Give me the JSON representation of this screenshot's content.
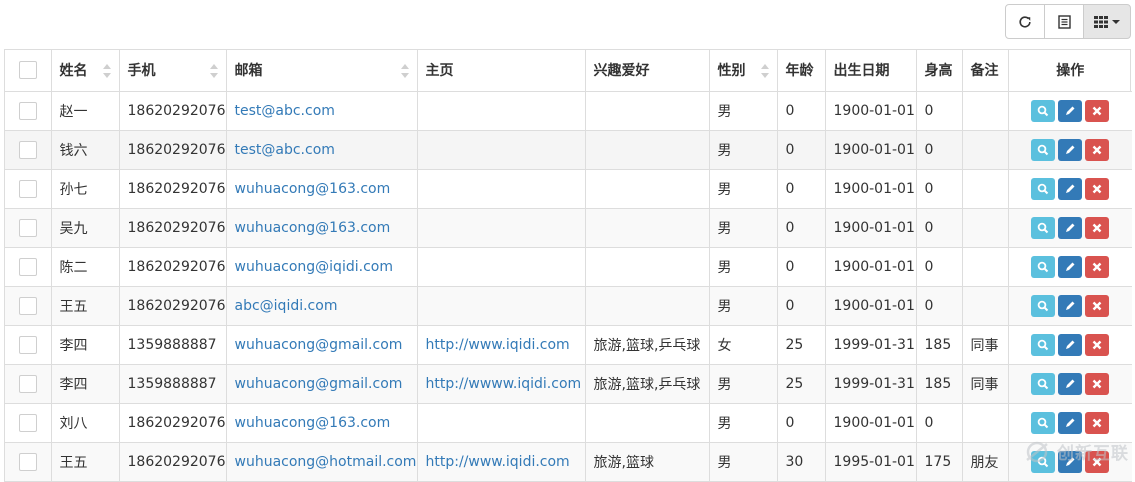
{
  "colors": {
    "view": "#5bc0de",
    "edit": "#337ab7",
    "delete": "#d9534f",
    "link": "#337ab7",
    "border": "#dddddd"
  },
  "toolbar": {
    "refresh_icon": "refresh-icon",
    "toggle_view_icon": "list-view-icon",
    "columns_icon": "columns-grid-icon"
  },
  "headers": {
    "name": "姓名",
    "phone": "手机",
    "email": "邮箱",
    "homepage": "主页",
    "hobby": "兴趣爱好",
    "gender": "性别",
    "age": "年龄",
    "birthday": "出生日期",
    "height": "身高",
    "remark": "备注",
    "actions": "操作"
  },
  "rows": [
    {
      "name": "赵一",
      "phone": "18620292076",
      "email": "test@abc.com",
      "homepage": "",
      "hobby": "",
      "gender": "男",
      "age": "0",
      "birthday": "1900-01-01",
      "height": "0",
      "remark": ""
    },
    {
      "name": "钱六",
      "phone": "18620292076",
      "email": "test@abc.com",
      "homepage": "",
      "hobby": "",
      "gender": "男",
      "age": "0",
      "birthday": "1900-01-01",
      "height": "0",
      "remark": ""
    },
    {
      "name": "孙七",
      "phone": "18620292076",
      "email": "wuhuacong@163.com",
      "homepage": "",
      "hobby": "",
      "gender": "男",
      "age": "0",
      "birthday": "1900-01-01",
      "height": "0",
      "remark": ""
    },
    {
      "name": "吴九",
      "phone": "18620292076",
      "email": "wuhuacong@163.com",
      "homepage": "",
      "hobby": "",
      "gender": "男",
      "age": "0",
      "birthday": "1900-01-01",
      "height": "0",
      "remark": ""
    },
    {
      "name": "陈二",
      "phone": "18620292076",
      "email": "wuhuacong@iqidi.com",
      "homepage": "",
      "hobby": "",
      "gender": "男",
      "age": "0",
      "birthday": "1900-01-01",
      "height": "0",
      "remark": ""
    },
    {
      "name": "王五",
      "phone": "18620292076",
      "email": "abc@iqidi.com",
      "homepage": "",
      "hobby": "",
      "gender": "男",
      "age": "0",
      "birthday": "1900-01-01",
      "height": "0",
      "remark": ""
    },
    {
      "name": "李四",
      "phone": "1359888887",
      "email": "wuhuacong@gmail.com",
      "homepage": "http://www.iqidi.com",
      "hobby": "旅游,篮球,乒乓球",
      "gender": "女",
      "age": "25",
      "birthday": "1999-01-31",
      "height": "185",
      "remark": "同事"
    },
    {
      "name": "李四",
      "phone": "1359888887",
      "email": "wuhuacong@gmail.com",
      "homepage": "http://wwww.iqidi.com",
      "hobby": "旅游,篮球,乒乓球",
      "gender": "男",
      "age": "25",
      "birthday": "1999-01-31",
      "height": "185",
      "remark": "同事"
    },
    {
      "name": "刘八",
      "phone": "18620292076",
      "email": "wuhuacong@163.com",
      "homepage": "",
      "hobby": "",
      "gender": "男",
      "age": "0",
      "birthday": "1900-01-01",
      "height": "0",
      "remark": ""
    },
    {
      "name": "王五",
      "phone": "18620292076",
      "email": "wuhuacong@hotmail.com",
      "homepage": "http://www.iqidi.com",
      "hobby": "旅游,篮球",
      "gender": "男",
      "age": "30",
      "birthday": "1995-01-01",
      "height": "175",
      "remark": "朋友"
    }
  ],
  "watermark": {
    "text": "创新互联",
    "icon": "watermark-logo-icon"
  }
}
